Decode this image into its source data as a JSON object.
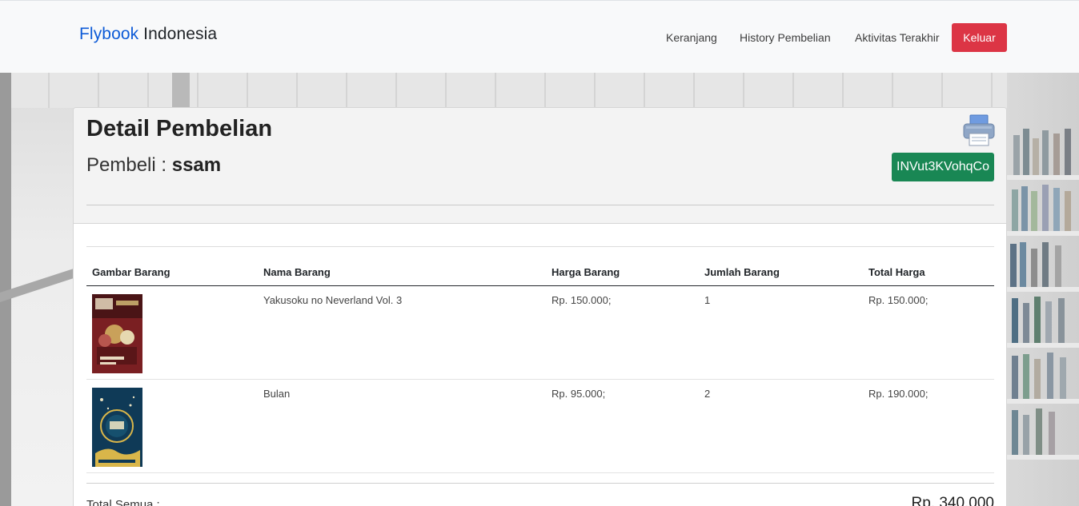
{
  "navbar": {
    "brand_part1": "Flybook",
    "brand_part2": "Indonesia",
    "links": [
      "Keranjang",
      "History Pembelian",
      "Aktivitas Terakhir"
    ],
    "logout_label": "Keluar"
  },
  "detail": {
    "title": "Detail Pembelian",
    "buyer_label": "Pembeli :",
    "buyer_name": "ssam",
    "invoice_code": "INVut3KVohqCo",
    "icons": {
      "print": "printer-icon"
    }
  },
  "table": {
    "headers": [
      "Gambar Barang",
      "Nama Barang",
      "Harga Barang",
      "Jumlah Barang",
      "Total Harga"
    ],
    "rows": [
      {
        "name": "Yakusoku no Neverland Vol. 3",
        "price": "Rp. 150.000;",
        "qty": "1",
        "total": "Rp. 150.000;"
      },
      {
        "name": "Bulan",
        "price": "Rp. 95.000;",
        "qty": "2",
        "total": "Rp. 190.000;"
      }
    ]
  },
  "summary": {
    "total_label": "Total Semua :",
    "total_value": "Rp. 340.000"
  },
  "colors": {
    "brand_blue": "#0d5bd7",
    "logout_red": "#dc3545",
    "invoice_green": "#198754"
  }
}
